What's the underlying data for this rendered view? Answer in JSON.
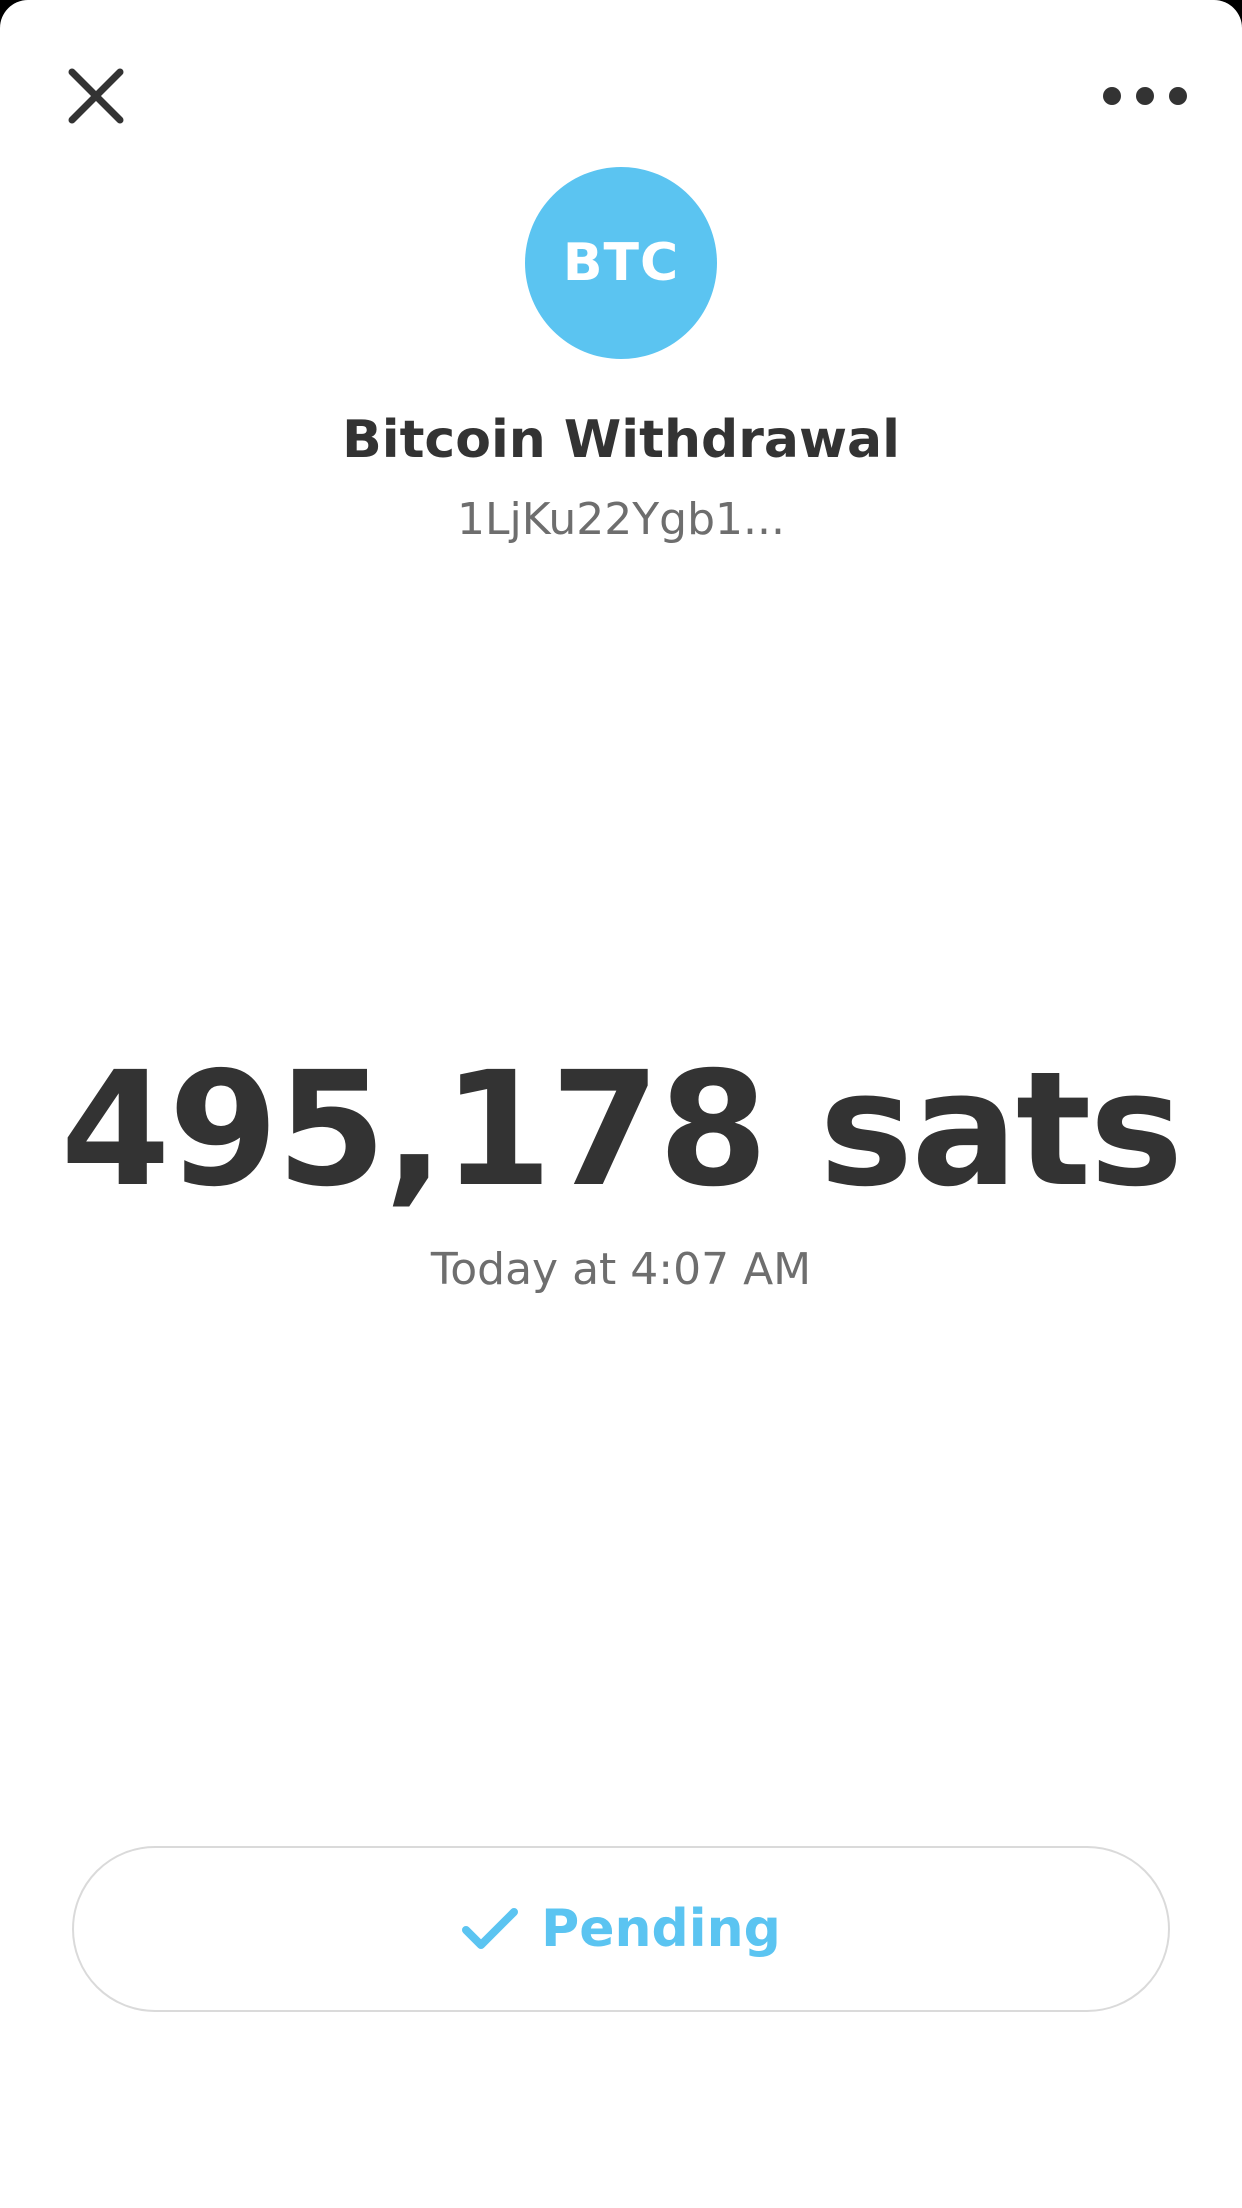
{
  "avatar": {
    "text": "BTC",
    "color": "#5bc4f1"
  },
  "header": {
    "close_icon": "close-icon",
    "more_icon": "more-horizontal-icon"
  },
  "transaction": {
    "title": "Bitcoin Withdrawal",
    "address": "1LjKu22Ygb1...",
    "amount": "495,178 sats",
    "timestamp": "Today at 4:07 AM"
  },
  "status": {
    "label": "Pending",
    "icon": "checkmark-icon",
    "color": "#5bc4f1"
  }
}
